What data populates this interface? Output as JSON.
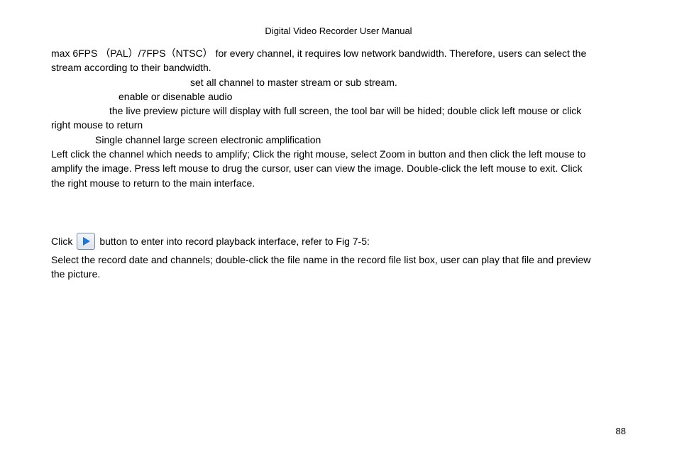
{
  "header": {
    "title": "Digital Video Recorder User Manual"
  },
  "content": {
    "p1a": "max 6FPS  （PAL）/7FPS（NTSC）  for every channel, it requires low network bandwidth. Therefore, users can select the",
    "p1b": "stream according to their bandwidth.",
    "p2": "set all channel to master stream or sub stream.",
    "p3": "enable or disenable audio",
    "p4a": "the live preview picture will display with full screen, the tool bar will be hided; double click left mouse or click",
    "p4b": "right mouse to return",
    "p5": "Single channel large screen electronic amplification",
    "p6a": "Left click the channel which needs to amplify; Click the right mouse, select Zoom in button and then click the left mouse to",
    "p6b": "amplify the image. Press left mouse to drug the cursor, user can view the image. Double-click the left mouse to exit. Click",
    "p6c": "the right mouse to return to the main interface."
  },
  "playback": {
    "click_label": "Click",
    "after_button": "button to enter into record playback interface, refer to Fig 7-5:",
    "p1a": "Select the record date and channels; double-click the file name in the record file list box, user can play that file and preview",
    "p1b": "the picture."
  },
  "page_number": "88"
}
